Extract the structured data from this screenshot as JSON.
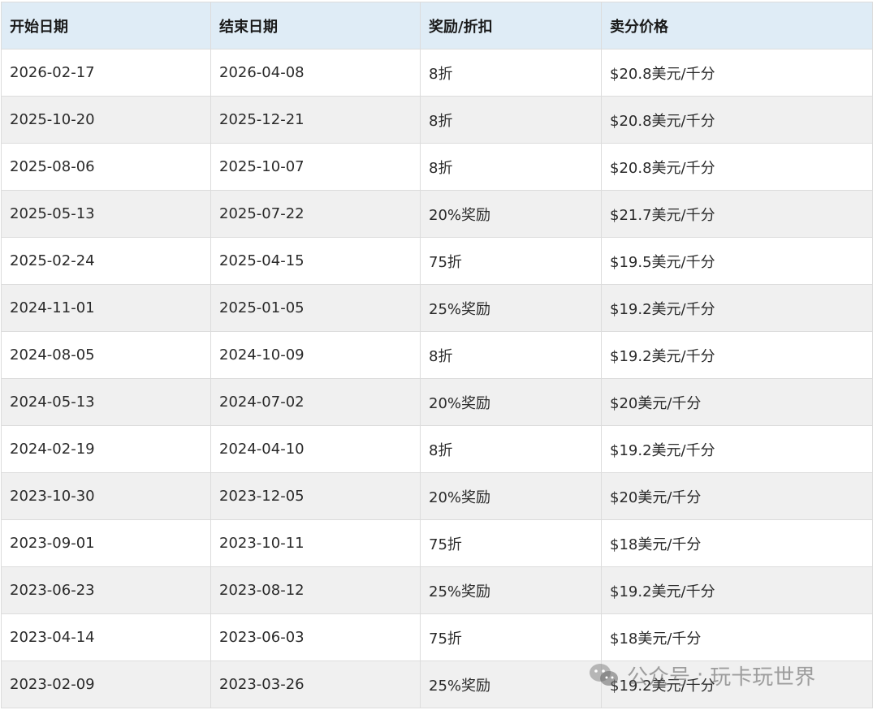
{
  "table": {
    "headers": [
      "开始日期",
      "结束日期",
      "奖励/折扣",
      "卖分价格"
    ],
    "rows": [
      [
        "2026-02-17",
        "2026-04-08",
        "8折",
        "$20.8美元/千分"
      ],
      [
        "2025-10-20",
        "2025-12-21",
        "8折",
        "$20.8美元/千分"
      ],
      [
        "2025-08-06",
        "2025-10-07",
        "8折",
        "$20.8美元/千分"
      ],
      [
        "2025-05-13",
        "2025-07-22",
        "20%奖励",
        "$21.7美元/千分"
      ],
      [
        "2025-02-24",
        "2025-04-15",
        "75折",
        "$19.5美元/千分"
      ],
      [
        "2024-11-01",
        "2025-01-05",
        "25%奖励",
        "$19.2美元/千分"
      ],
      [
        "2024-08-05",
        "2024-10-09",
        "8折",
        "$19.2美元/千分"
      ],
      [
        "2024-05-13",
        "2024-07-02",
        "20%奖励",
        "$20美元/千分"
      ],
      [
        "2024-02-19",
        "2024-04-10",
        "8折",
        "$19.2美元/千分"
      ],
      [
        "2023-10-30",
        "2023-12-05",
        "20%奖励",
        "$20美元/千分"
      ],
      [
        "2023-09-01",
        "2023-10-11",
        "75折",
        "$18美元/千分"
      ],
      [
        "2023-06-23",
        "2023-08-12",
        "25%奖励",
        "$19.2美元/千分"
      ],
      [
        "2023-04-14",
        "2023-06-03",
        "75折",
        "$18美元/千分"
      ],
      [
        "2023-02-09",
        "2023-03-26",
        "25%奖励",
        "$19.2美元/千分"
      ]
    ]
  },
  "watermark": {
    "icon": "wechat-icon",
    "label": "公众号",
    "separator": "·",
    "account": "玩卡玩世界"
  },
  "colors": {
    "header_bg": "#dfecf6",
    "stripe_bg": "#f0f0f0",
    "border": "#dcdcdc"
  }
}
